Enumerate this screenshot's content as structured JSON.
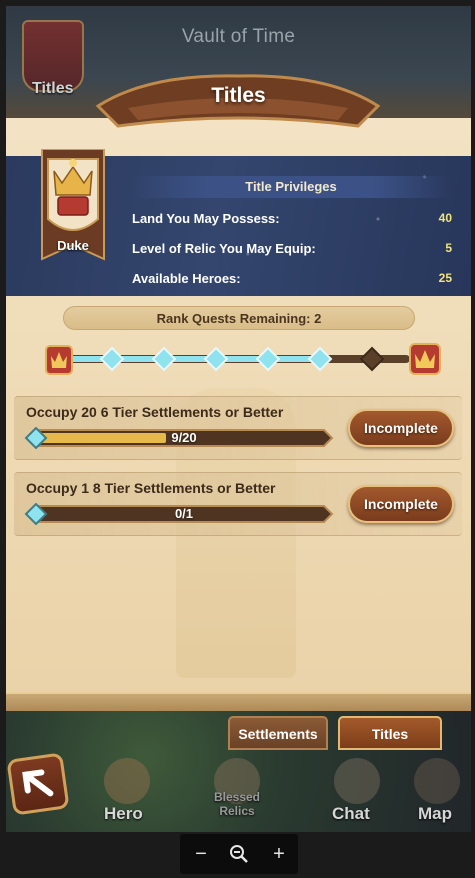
{
  "background": {
    "screen_title": "Vault of Time",
    "titles_label": "Titles"
  },
  "header": {
    "title": "Titles"
  },
  "rank": {
    "name": "Duke"
  },
  "privileges": {
    "heading": "Title Privileges",
    "rows": [
      {
        "label": "Land You May Possess:",
        "value": "40"
      },
      {
        "label": "Level of Relic You May Equip:",
        "value": "5"
      },
      {
        "label": "Available Heroes:",
        "value": "25"
      }
    ]
  },
  "rank_quests": {
    "label": "Rank Quests Remaining: 2",
    "nodes_total": 6,
    "nodes_completed": 5
  },
  "quests": [
    {
      "title": "Occupy 20 6 Tier Settlements or Better",
      "progress_text": "9/20",
      "progress": 0.45,
      "button": "Incomplete"
    },
    {
      "title": "Occupy 1 8 Tier Settlements or Better",
      "progress_text": "0/1",
      "progress": 0,
      "button": "Incomplete"
    }
  ],
  "tabs": {
    "settlements": "Settlements",
    "titles": "Titles"
  },
  "nav": {
    "hero": "Hero",
    "blessed_relics": "Blessed Relics",
    "chat": "Chat",
    "map": "Map"
  },
  "zoom": {
    "minus": "−",
    "plus": "+"
  },
  "colors": {
    "parchment": "#efdcb8",
    "banner_blue": "#2b3a5e",
    "accent_cyan": "#8fe3ee",
    "button_brown": "#8f4a25",
    "privilege_value": "#f4e27a"
  }
}
